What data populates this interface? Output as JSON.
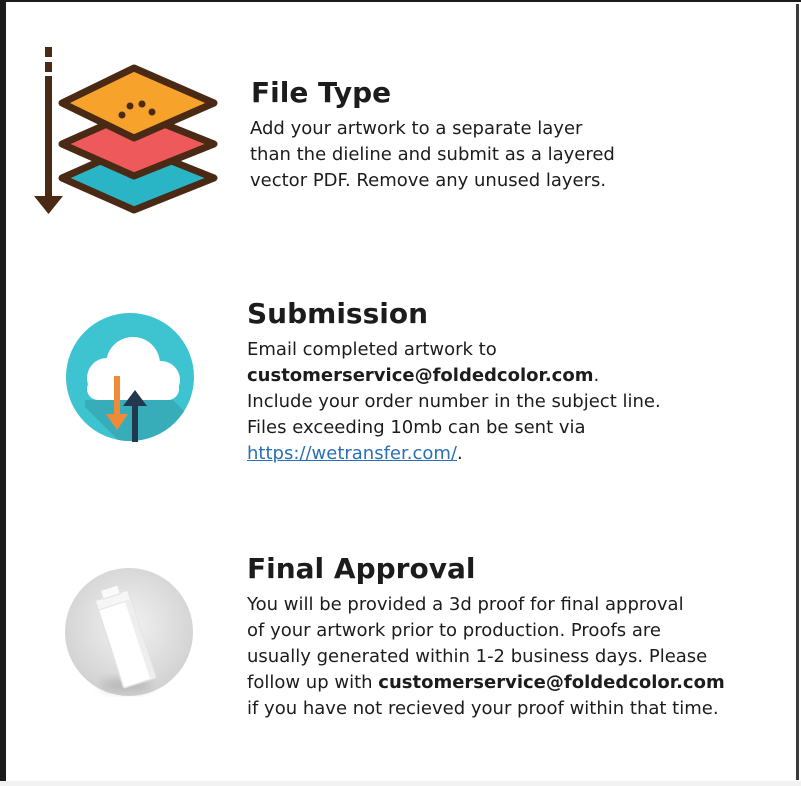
{
  "colors": {
    "frame": "#1b1b1b",
    "text": "#1c1c1c",
    "link": "#2a6fb6",
    "layer_top": "#f7a22b",
    "layer_mid": "#ee5a5c",
    "layer_bottom": "#2ab5c6",
    "layer_outline": "#4a2a14",
    "cloud_circle": "#3ec3d0",
    "arrow_down": "#f08a36",
    "arrow_up": "#22384f",
    "proof_circle": "#dcdcdc"
  },
  "file_type": {
    "icon": "stacked-layers-icon",
    "heading": "File Type",
    "lines": [
      "Add your artwork to a separate layer",
      "than the dieline and submit as a layered",
      "vector PDF. Remove any unused layers."
    ]
  },
  "submission": {
    "icon": "cloud-upload-download-icon",
    "heading": "Submission",
    "line1": "Email completed artwork to",
    "email": "customerservice@foldedcolor.com",
    "email_suffix": ".",
    "line3": "Include your order number in the subject line.",
    "line4": "Files exceeding 10mb can be sent via",
    "link_text": "https://wetransfer.com/",
    "link_suffix": "."
  },
  "final_approval": {
    "icon": "3d-proof-box-icon",
    "heading": "Final Approval",
    "line1": "You will be provided a 3d proof for final approval",
    "line2": "of your artwork prior to production. Proofs are",
    "line3": "usually generated within 1-2 business days. Please",
    "line4_prefix": "follow up with ",
    "email": "customerservice@foldedcolor.com",
    "line5": "if you have not recieved your proof within that time."
  }
}
